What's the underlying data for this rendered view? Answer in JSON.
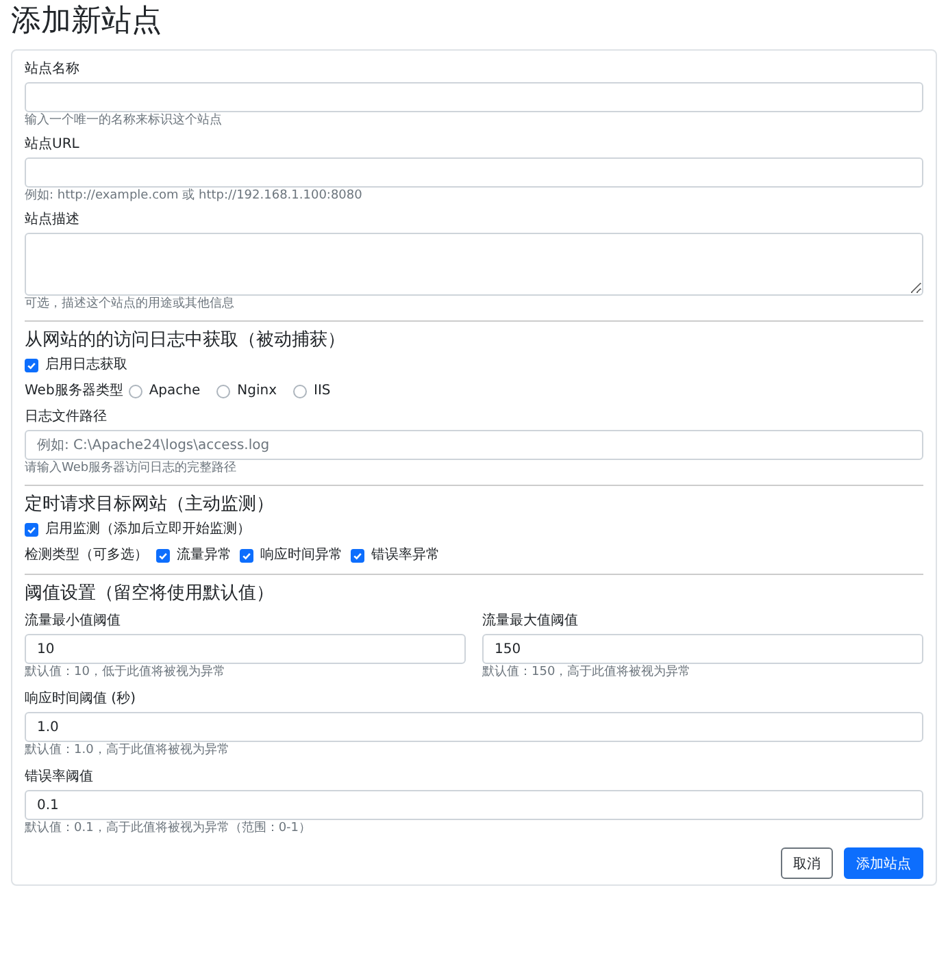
{
  "title": "添加新站点",
  "basic_fields": [
    {
      "kind": "input",
      "label": "站点名称",
      "help": "输入一个唯一的名称来标识这个站点"
    },
    {
      "kind": "input",
      "label": "站点URL",
      "help": "例如: http://example.com 或 http://192.168.1.100:8080"
    },
    {
      "kind": "textarea",
      "label": "站点描述",
      "help": "可选，描述这个站点的用途或其他信息"
    }
  ],
  "log_section": {
    "heading": "从网站的的访问日志中获取（被动捕获）",
    "enable": {
      "label": "启用日志获取",
      "checked": true
    },
    "server_type": {
      "label": "Web服务器类型",
      "options": [
        {
          "label": "Apache",
          "selected": false
        },
        {
          "label": "Nginx",
          "selected": false
        },
        {
          "label": "IIS",
          "selected": false
        }
      ]
    },
    "path_field": {
      "label": "日志文件路径",
      "placeholder": "例如: C:\\Apache24\\logs\\access.log",
      "help": "请输入Web服务器访问日志的完整路径"
    }
  },
  "monitor_section": {
    "heading": "定时请求目标网站（主动监测）",
    "enable": {
      "label": "启用监测（添加后立即开始监测）",
      "checked": true
    },
    "detect_types": {
      "label": "检测类型（可多选）",
      "options": [
        {
          "label": "流量异常",
          "checked": true
        },
        {
          "label": "响应时间异常",
          "checked": true
        },
        {
          "label": "错误率异常",
          "checked": true
        }
      ]
    }
  },
  "threshold_section": {
    "heading": "阈值设置（留空将使用默认值）",
    "rows": [
      [
        {
          "label": "流量最小值阈值",
          "value": "10",
          "help": "默认值：10，低于此值将被视为异常"
        },
        {
          "label": "流量最大值阈值",
          "value": "150",
          "help": "默认值：150，高于此值将被视为异常"
        }
      ],
      [
        {
          "label": "响应时间阈值 (秒)",
          "value": "1.0",
          "help": "默认值：1.0，高于此值将被视为异常"
        }
      ],
      [
        {
          "label": "错误率阈值",
          "value": "0.1",
          "help": "默认值：0.1，高于此值将被视为异常（范围：0-1）"
        }
      ]
    ]
  },
  "buttons": [
    {
      "kind": "secondary",
      "label": "取消"
    },
    {
      "kind": "primary",
      "label": "添加站点"
    }
  ]
}
